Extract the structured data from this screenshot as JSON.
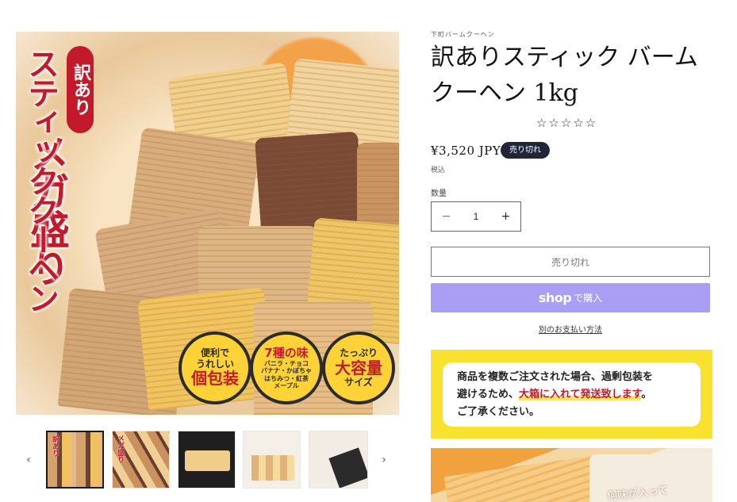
{
  "product": {
    "vendor": "下町バームクーヘン",
    "title": "訳ありスティック バームクーヘン 1kg",
    "rating_stars": "☆☆☆☆☆",
    "price": "¥3,520 JPY",
    "sold_out_badge": "売り切れ",
    "tax_note": "税込",
    "quantity_label": "数量",
    "quantity_value": "1",
    "quantity_minus": "−",
    "quantity_plus": "+",
    "sold_out_button": "売り切れ",
    "shop_pay": {
      "logo": "shop",
      "suffix": "で購入"
    },
    "more_payment_options": "別のお支払い方法"
  },
  "main_image": {
    "wake_badge": "訳あり",
    "vertical_line_1": "メガ盛り",
    "vertical_line_2": "スティッククーヘン",
    "badges": [
      {
        "line1": "便利で",
        "line2": "うれしい",
        "big": "個包装"
      },
      {
        "line1": "7種の味",
        "line2": "バニラ・チョコ",
        "line3": "バナナ・かぼちゃ",
        "line4": "はちみつ・紅茶",
        "line5": "メープル"
      },
      {
        "line1": "たっぷり",
        "big": "大容量",
        "line2": "サイズ"
      }
    ]
  },
  "gallery": {
    "prev_arrow": "‹",
    "next_arrow": "›",
    "thumbs": [
      {
        "tag": "訳あり"
      },
      {
        "tag": "メガ盛り"
      },
      {
        "tag": ""
      },
      {
        "tag": ""
      },
      {
        "tag": ""
      }
    ]
  },
  "notice": {
    "line1": "商品を複数ご注文された場合、過剰包装を",
    "line2_pre": "避けるため、",
    "line2_hl": "大箱に入れて発送致します",
    "line2_post": "。",
    "line3": "ご了承ください。"
  },
  "promo_photo": {
    "text": "何味が入って"
  },
  "colors": {
    "accent_red": "#c21a2b",
    "shop_pay_purple": "#a99ef4",
    "notice_yellow": "#f8e22d",
    "badge_dark": "#22253a"
  }
}
